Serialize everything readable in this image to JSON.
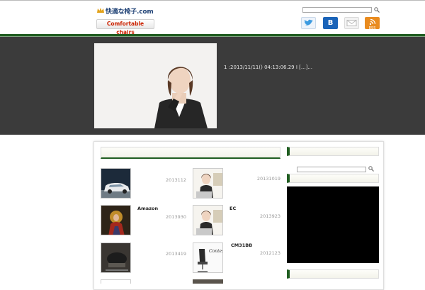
{
  "header": {
    "logo_text": "快適な椅子.com",
    "logo_sub": "Comfortable chairs",
    "search_placeholder": "",
    "share_buttons": [
      "twitter-icon",
      "hatena-bookmark-icon",
      "mail-icon",
      "rss-icon"
    ],
    "hatena_label": "B",
    "rss_label": "RSS"
  },
  "hero": {
    "caption": "1 :2013/11/11() 04:13:06.29 I [...]..."
  },
  "posts": [
    {
      "date": "2013112",
      "title": "",
      "thumb": "car"
    },
    {
      "date": "20131019",
      "title": "",
      "thumb": "woman"
    },
    {
      "date": "2013930",
      "title": "Amazon",
      "thumb": "painting"
    },
    {
      "date": "2013923",
      "title": "EC",
      "thumb": "woman"
    },
    {
      "date": "2013419",
      "title": "",
      "thumb": "chair"
    },
    {
      "date": "2012123",
      "title": "CM31BB",
      "thumb": "contessa"
    }
  ],
  "colors": {
    "accent_green": "#1f5d20",
    "hero_bg": "#3b3b3b"
  }
}
